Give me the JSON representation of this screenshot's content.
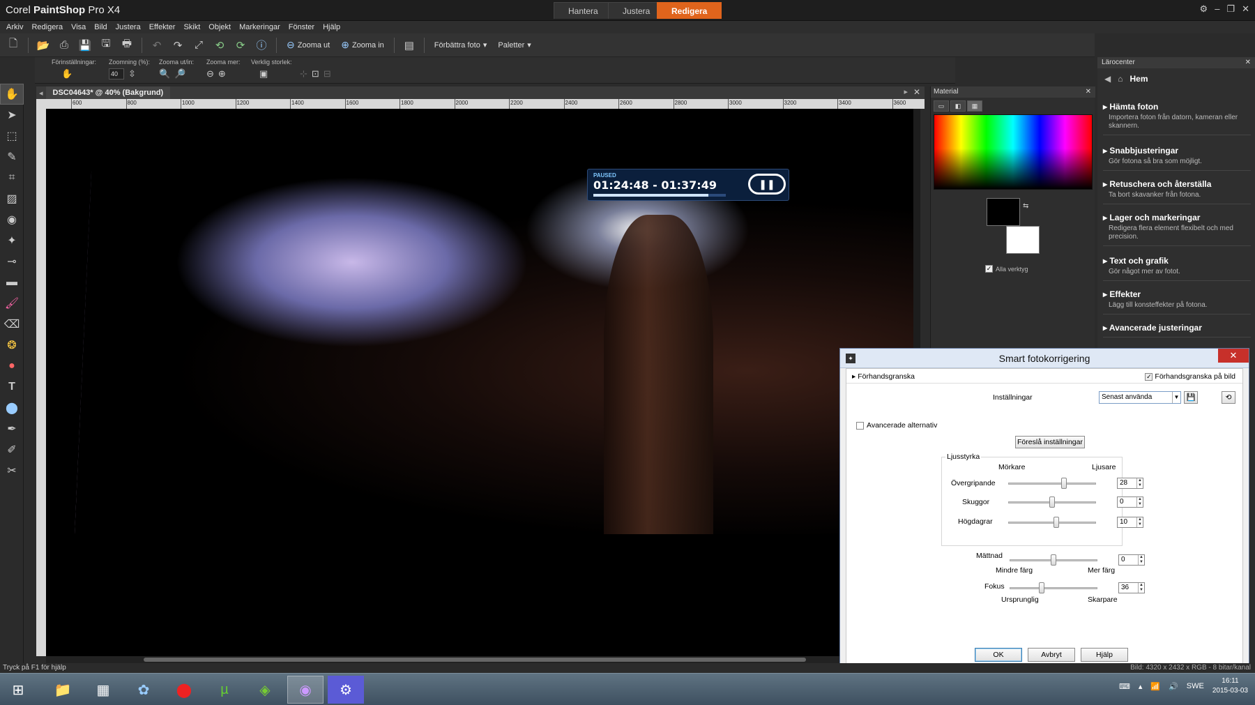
{
  "app": {
    "title_prefix": "Corel",
    "title_bold": "PaintShop",
    "title_suffix": "Pro X4",
    "window_controls": [
      "⚙",
      "–",
      "❐",
      "✕"
    ]
  },
  "mode_tabs": [
    {
      "label": "Hantera",
      "active": false
    },
    {
      "label": "Justera",
      "active": false
    },
    {
      "label": "Redigera",
      "active": true
    }
  ],
  "menu": [
    "Arkiv",
    "Redigera",
    "Visa",
    "Bild",
    "Justera",
    "Effekter",
    "Skikt",
    "Objekt",
    "Markeringar",
    "Fönster",
    "Hjälp"
  ],
  "toolbar": {
    "zoom_out": "Zooma ut",
    "zoom_in": "Zooma in",
    "enhance": "Förbättra foto",
    "palettes": "Paletter"
  },
  "options_bar": {
    "presets_label": "Förinställningar:",
    "zoom_pct_label": "Zoomning (%):",
    "zoom_value": "40",
    "zoom_inout_label": "Zooma ut/in:",
    "zoom_more_label": "Zooma mer:",
    "actual_size_label": "Verklig storlek:"
  },
  "document": {
    "tab_label": "DSC04643* @  40% (Bakgrund)",
    "ruler_labels": [
      "600",
      "800",
      "1000",
      "1200",
      "1400",
      "1600",
      "1800",
      "2000",
      "2200",
      "2400",
      "2600",
      "2800",
      "3000",
      "3200",
      "3400",
      "3600"
    ]
  },
  "player_overlay": {
    "status": "PAUSED",
    "time": "01:24:48 - 01:37:49",
    "progress": 0.87
  },
  "material": {
    "title": "Material",
    "all_tools": "Alla verktyg"
  },
  "learning_center": {
    "title": "Lärocenter",
    "home": "Hem",
    "items": [
      {
        "title": "Hämta foton",
        "desc": "Importera foton från datorn, kameran eller skannern."
      },
      {
        "title": "Snabbjusteringar",
        "desc": "Gör fotona så bra som möjligt."
      },
      {
        "title": "Retuschera och återställa",
        "desc": "Ta bort skavanker från fotona."
      },
      {
        "title": "Lager och markeringar",
        "desc": "Redigera flera element flexibelt och med precision."
      },
      {
        "title": "Text och grafik",
        "desc": "Gör något mer av fotot."
      },
      {
        "title": "Effekter",
        "desc": "Lägg till konsteffekter på fotona."
      },
      {
        "title": "Avancerade justeringar",
        "desc": ""
      }
    ]
  },
  "dialog": {
    "title": "Smart fotokorrigering",
    "preview_toggle": "Förhandsgranska",
    "preview_on_image": "Förhandsgranska på bild",
    "settings_label": "Inställningar",
    "settings_value": "Senast använda",
    "advanced": "Avancerade alternativ",
    "suggest": "Föreslå inställningar",
    "brightness": {
      "group": "Ljusstyrka",
      "darker": "Mörkare",
      "lighter": "Ljusare",
      "rows": [
        {
          "label": "Övergripande",
          "value": "28",
          "pos": 0.64
        },
        {
          "label": "Skuggor",
          "value": "0",
          "pos": 0.5
        },
        {
          "label": "Högdagrar",
          "value": "10",
          "pos": 0.55
        }
      ]
    },
    "saturation": {
      "label": "Mättnad",
      "value": "0",
      "pos": 0.5,
      "less": "Mindre färg",
      "more": "Mer färg"
    },
    "focus": {
      "label": "Fokus",
      "value": "36",
      "pos": 0.36,
      "orig": "Ursprunglig",
      "sharper": "Skarpare"
    },
    "buttons": {
      "ok": "OK",
      "cancel": "Avbryt",
      "help": "Hjälp"
    }
  },
  "status": {
    "hint": "Tryck på F1 för hjälp",
    "info": "Bild: 4320 x 2432 x RGB - 8 bitar/kanal"
  },
  "taskbar": {
    "lang": "SWE",
    "time": "16:11",
    "date": "2015-03-03"
  }
}
